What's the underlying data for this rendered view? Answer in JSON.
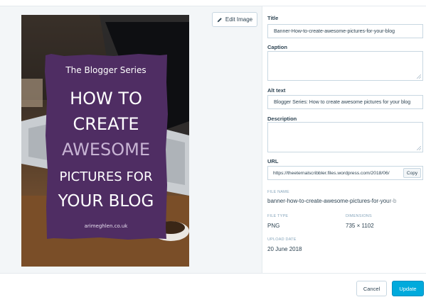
{
  "edit_image_label": "Edit Image",
  "image": {
    "series_text": "The Blogger Series",
    "headline_lines": [
      "HOW TO",
      "CREATE",
      "AWESOME",
      "PICTURES FOR",
      "YOUR BLOG"
    ],
    "site_text": "arimeghlen.co.uk",
    "colors": {
      "panel": "#4f2d63",
      "headline": "#ffffff",
      "accent": "#c8b4d4"
    }
  },
  "fields": {
    "title": {
      "label": "Title",
      "value": "Banner-How-to-create-awesome-pictures-for-your-blog"
    },
    "caption": {
      "label": "Caption",
      "value": ""
    },
    "alt_text": {
      "label": "Alt text",
      "value": "Blogger Series: How to create awesome pictures for your blog"
    },
    "description": {
      "label": "Description",
      "value": ""
    },
    "url": {
      "label": "URL",
      "value": "https://theeternalscribbler.files.wordpress.com/2018/06/",
      "copy_label": "Copy"
    }
  },
  "file_info": {
    "file_name_label": "FILE NAME",
    "file_name": "banner-how-to-create-awesome-pictures-for-your-b",
    "file_type_label": "FILE TYPE",
    "file_type": "PNG",
    "dimensions_label": "DIMENSIONS",
    "dimensions": "735 × 1102",
    "upload_date_label": "UPLOAD DATE",
    "upload_date": "20 June 2018"
  },
  "actions": {
    "cancel_label": "Cancel",
    "update_label": "Update"
  },
  "theme": {
    "primary": "#00aadc",
    "border": "#c8d7e1",
    "muted": "#87a6bc",
    "text": "#2e4453"
  }
}
